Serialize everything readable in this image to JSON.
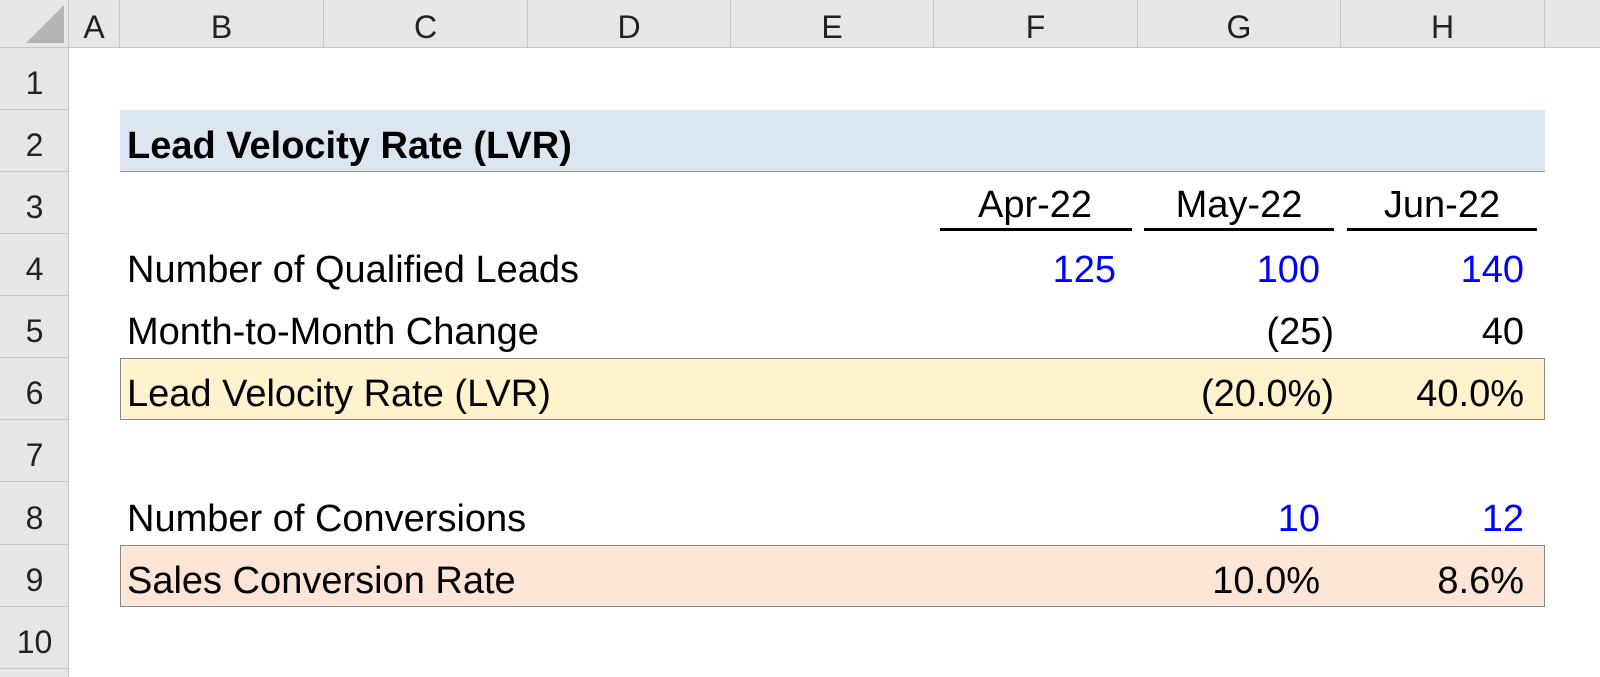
{
  "colors": {
    "header_bg": "#e6e6e6",
    "title_band": "#dce6f1",
    "lvr_band": "#fff2cc",
    "conversion_band": "#fce4d6",
    "input_blue": "#0000ff"
  },
  "columns": [
    "A",
    "B",
    "C",
    "D",
    "E",
    "F",
    "G",
    "H"
  ],
  "rows": [
    "1",
    "2",
    "3",
    "4",
    "5",
    "6",
    "7",
    "8",
    "9",
    "10"
  ],
  "sheet": {
    "title": "Lead Velocity Rate (LVR)",
    "months": [
      "Apr-22",
      "May-22",
      "Jun-22"
    ],
    "qualified_leads": {
      "label": "Number of Qualified Leads",
      "values": [
        "125",
        "100",
        "140"
      ]
    },
    "mom_change": {
      "label": "Month-to-Month Change",
      "values": [
        "(25)",
        "40"
      ]
    },
    "lvr": {
      "label": "Lead Velocity Rate (LVR)",
      "values": [
        "(20.0%)",
        "40.0%"
      ]
    },
    "conversions": {
      "label": "Number of Conversions",
      "values": [
        "10",
        "12"
      ]
    },
    "conversion_rate": {
      "label": "Sales Conversion Rate",
      "values": [
        "10.0%",
        "8.6%"
      ]
    }
  }
}
